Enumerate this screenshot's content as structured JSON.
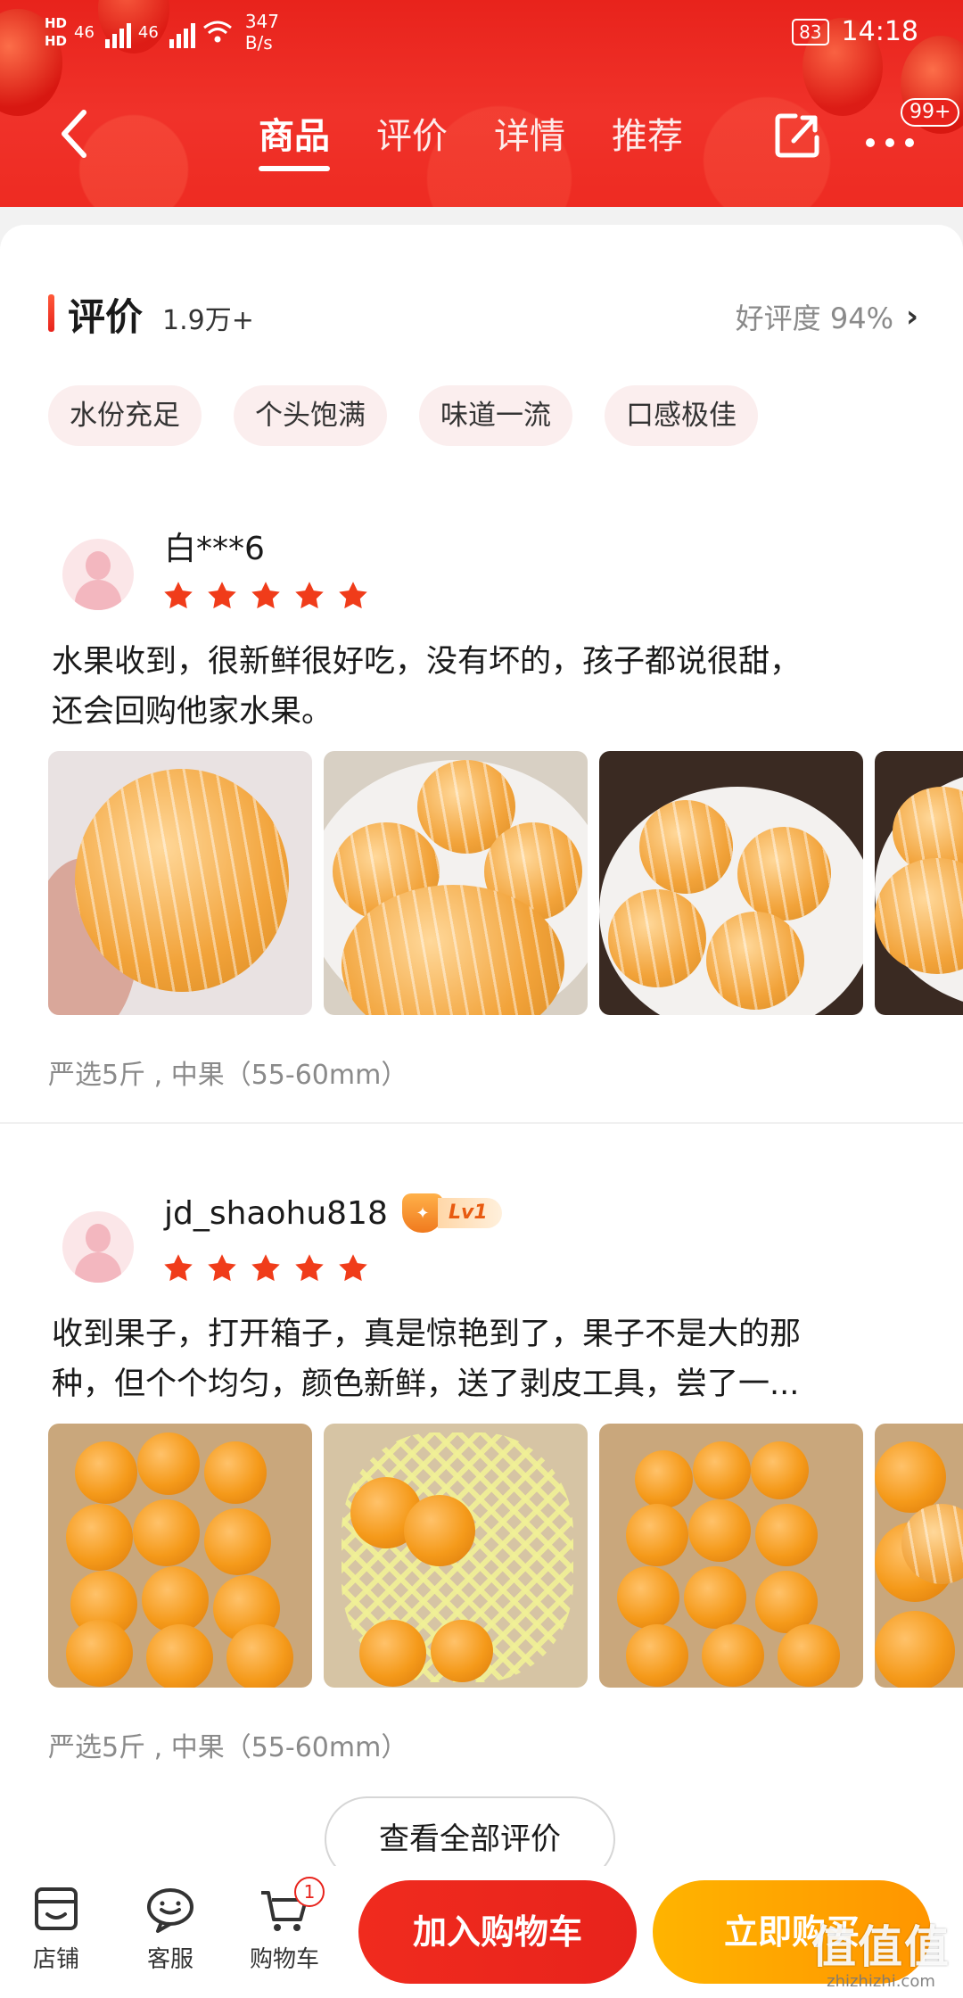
{
  "status_bar": {
    "hd1": "HD",
    "hd2": "HD",
    "signal1": "46",
    "signal2": "46",
    "net_speed_value": "347",
    "net_speed_unit": "B/s",
    "battery": "83",
    "time": "14:18"
  },
  "nav": {
    "tabs": [
      {
        "label": "商品",
        "active": true
      },
      {
        "label": "评价",
        "active": false
      },
      {
        "label": "详情",
        "active": false
      },
      {
        "label": "推荐",
        "active": false
      }
    ],
    "more_badge": "99+"
  },
  "reviews_section": {
    "title": "评价",
    "count": "1.9万+",
    "positive_rate": "好评度 94%",
    "tags": [
      "水份充足",
      "个头饱满",
      "味道一流",
      "口感极佳"
    ],
    "items": [
      {
        "user": "白***6",
        "rating": 5,
        "text_line1": "水果收到，很新鲜很好吃，没有坏的，孩子都说很甜，",
        "text_line2": "还会回购他家水果。",
        "spec": "严选5斤 , 中果（55-60mm）"
      },
      {
        "user": "jd_shaohu818",
        "level": "Lv1",
        "rating": 5,
        "text_line1": "收到果子，打开箱子，真是惊艳到了，果子不是大的那",
        "text_line2": "种，但个个均匀，颜色新鲜，送了剥皮工具，尝了一...",
        "spec": "严选5斤 , 中果（55-60mm）"
      }
    ],
    "view_all": "查看全部评价"
  },
  "bottom_bar": {
    "shop": "店铺",
    "service": "客服",
    "cart": "购物车",
    "cart_count": "1",
    "add_to_cart": "加入购物车",
    "buy_now": "立即购买"
  },
  "watermark": {
    "big": "值值值",
    "small": "zhizhizhi.com"
  },
  "colors": {
    "brand_red": "#e8231c",
    "buy_orange": "#ff9f00",
    "tag_bg": "#fbeeee",
    "star": "#f03c1a"
  }
}
